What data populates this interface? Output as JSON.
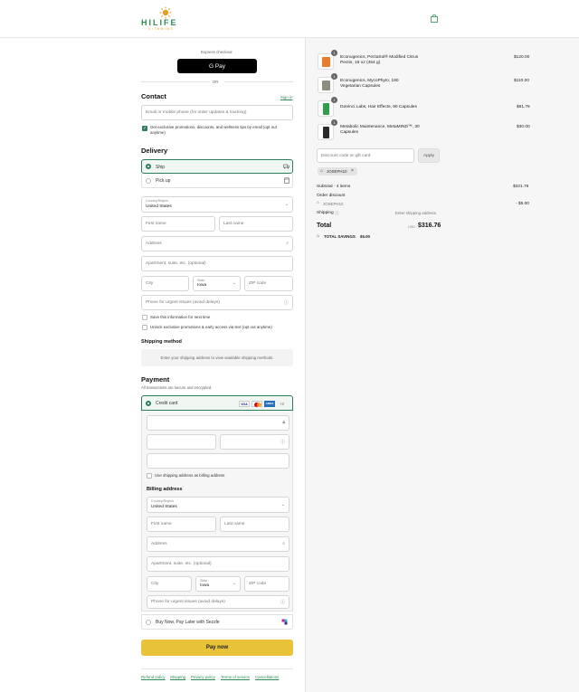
{
  "header": {
    "logo_text": "HILIFE",
    "logo_sub": "VITAMINS",
    "colors": {
      "logo_green": "#2e8b57",
      "logo_orange": "#e0a020"
    }
  },
  "express": {
    "label": "Express checkout",
    "gpay": "G Pay",
    "or": "OR"
  },
  "contact": {
    "title": "Contact",
    "sign_in": "Sign in",
    "email_placeholder": "Email or mobile phone (for order updates & tracking)",
    "promo_check": "Get exclusive promotions, discounts, and wellness tips by email (opt out anytime)"
  },
  "delivery": {
    "title": "Delivery",
    "ship": "Ship",
    "pickup": "Pick up",
    "country_label": "Country/Region",
    "country_value": "United States",
    "first_name": "First name",
    "last_name": "Last name",
    "address": "Address",
    "apartment": "Apartment, suite, etc. (optional)",
    "city": "City",
    "state_label": "State",
    "state_value": "Iowa",
    "zip": "ZIP code",
    "phone": "Phone for urgent issues (avoid delays)",
    "save_info": "Save this information for next time",
    "sms_promo": "Unlock exclusive promotions & early access via text (opt out anytime)"
  },
  "shipping_method": {
    "title": "Shipping method",
    "placeholder": "Enter your shipping address to view available shipping methods."
  },
  "payment": {
    "title": "Payment",
    "subtitle": "All transactions are secure and encrypted.",
    "credit_card": "Credit card",
    "card_badges": [
      "VISA",
      "MC",
      "AMEX",
      "+3"
    ],
    "use_shipping": "Use shipping address as billing address",
    "billing_title": "Billing address",
    "sezzle": "Buy Now, Pay Later with Sezzle",
    "pay_now": "Pay now",
    "colors": {
      "pay_button": "#e8c33a"
    }
  },
  "footer_links": [
    "Refund policy",
    "Shipping",
    "Privacy policy",
    "Terms of service",
    "Cancellations"
  ],
  "cart": {
    "items": [
      {
        "qty": "1",
        "name": "Econugenics, PectaSol® Modified Citrus Pectin, 16 oz (454 g)",
        "price": "$120.00"
      },
      {
        "qty": "1",
        "name": "Econugenics, MycoPhyto, 180 Vegetarian Capsules",
        "price": "$110.00"
      },
      {
        "qty": "1",
        "name": "DaVinci Labs, Hair Effects, 90 Capsules",
        "price": "$61.76"
      },
      {
        "qty": "1",
        "name": "Metabolic Maintenance, MetaMIND™, 30 Capsules",
        "price": "$30.00"
      }
    ],
    "discount_placeholder": "Discount code or gift card",
    "apply": "Apply",
    "code_tag": "JOSEPH10",
    "subtotal_label": "Subtotal · 4 items",
    "subtotal_value": "$321.76",
    "order_discount": "Order discount",
    "code_line": "JOSEPH10",
    "code_amount": "- $5.00",
    "shipping_label": "Shipping",
    "shipping_value": "Enter shipping address",
    "total_label": "Total",
    "currency": "USD",
    "total_value": "$316.76",
    "savings_label": "TOTAL SAVINGS",
    "savings_value": "$5.00"
  }
}
